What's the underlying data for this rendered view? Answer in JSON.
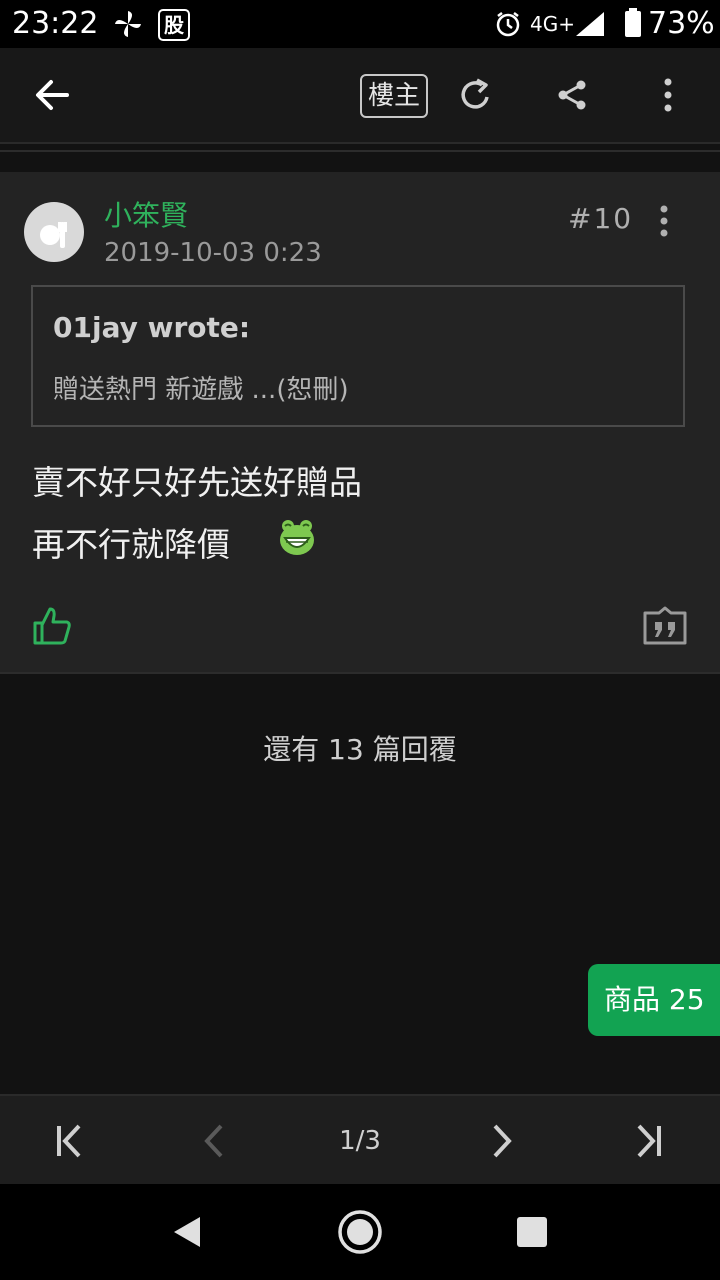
{
  "status_bar": {
    "time": "23:22",
    "stock_badge": "股",
    "network": "4G+",
    "battery": "73%",
    "icons": [
      "pinwheel-icon",
      "stock-app-icon",
      "alarm-icon",
      "signal-icon",
      "battery-icon"
    ]
  },
  "app_bar": {
    "back_icon": "arrow-left-icon",
    "op_only_label": "樓主",
    "refresh_icon": "refresh-icon",
    "share_icon": "share-icon",
    "more_icon": "more-vertical-icon"
  },
  "post": {
    "author": "小笨賢",
    "timestamp": "2019-10-03 0:23",
    "floor": "#10",
    "quote": {
      "author": "01jay wrote:",
      "text": "贈送熱門 新遊戲 ...(恕刪)"
    },
    "body_lines": [
      "賣不好只好先送好贈品",
      "再不行就降價"
    ],
    "emoji_icon": "laughing-frog-emoji-icon",
    "like_icon": "thumbs-up-icon",
    "quote_icon": "quote-reply-icon"
  },
  "more_replies_text": "還有 13 篇回覆",
  "products_button": "商品 25",
  "pager": {
    "page_indicator": "1/3",
    "icons": [
      "first-page-icon",
      "prev-page-icon",
      "next-page-icon",
      "last-page-icon"
    ]
  },
  "nav_bar": {
    "icons": [
      "back-triangle-icon",
      "home-circle-icon",
      "recents-square-icon"
    ]
  },
  "colors": {
    "accent_green": "#2fb25c",
    "button_green": "#12a352",
    "background": "#121212",
    "card": "#232323"
  }
}
